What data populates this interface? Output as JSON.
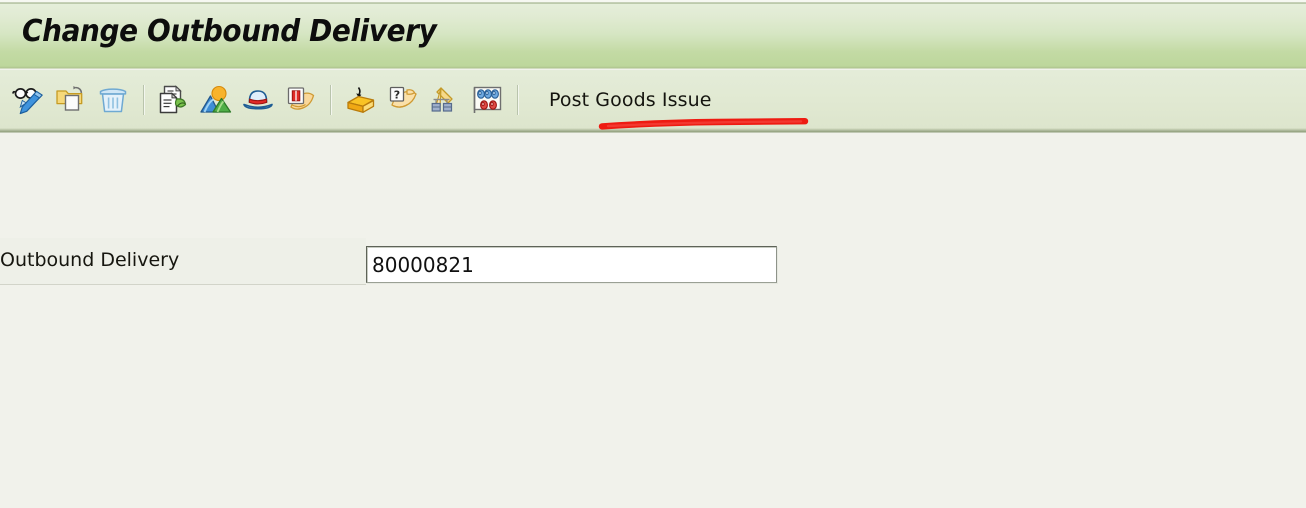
{
  "window": {
    "title": "Change Outbound Delivery"
  },
  "toolbar": {
    "buttons": [
      {
        "name": "display-change-toggle-icon",
        "tooltip": "Display/Change"
      },
      {
        "name": "other-document-icon",
        "tooltip": "Other Outbound Delivery"
      },
      {
        "name": "delete-trash-icon",
        "tooltip": "Delete"
      },
      {
        "name": "document-flow-icon",
        "tooltip": "Document Flow"
      },
      {
        "name": "overview-landscape-icon",
        "tooltip": "Overview"
      },
      {
        "name": "blue-hat-icon",
        "tooltip": "Display Document Header"
      },
      {
        "name": "hand-red-book-icon",
        "tooltip": "Output"
      },
      {
        "name": "packing-box-icon",
        "tooltip": "Pack"
      },
      {
        "name": "hand-question-card-icon",
        "tooltip": "Check"
      },
      {
        "name": "crane-loading-icon",
        "tooltip": "Loading"
      },
      {
        "name": "status-board-icon",
        "tooltip": "Status Overview"
      }
    ],
    "separators_after": [
      2,
      6
    ],
    "post_goods_issue_label": "Post Goods Issue"
  },
  "annotation": {
    "type": "red-underline",
    "color": "#ee1b12",
    "targets": "Post Goods Issue"
  },
  "form": {
    "outbound_delivery": {
      "label": "Outbound Delivery",
      "value": "80000821",
      "placeholder": ""
    }
  },
  "colors": {
    "title_gradient_top": "#e5eeda",
    "title_gradient_bottom": "#bdd79c",
    "toolbar_bg": "#e1e9d2",
    "content_bg": "#f1f2eb",
    "label_strip_bg": "#eef0e8",
    "annotation_red": "#ee1b12",
    "text": "#15150f",
    "input_bg": "#ffffff",
    "input_border": "#5e6358"
  }
}
